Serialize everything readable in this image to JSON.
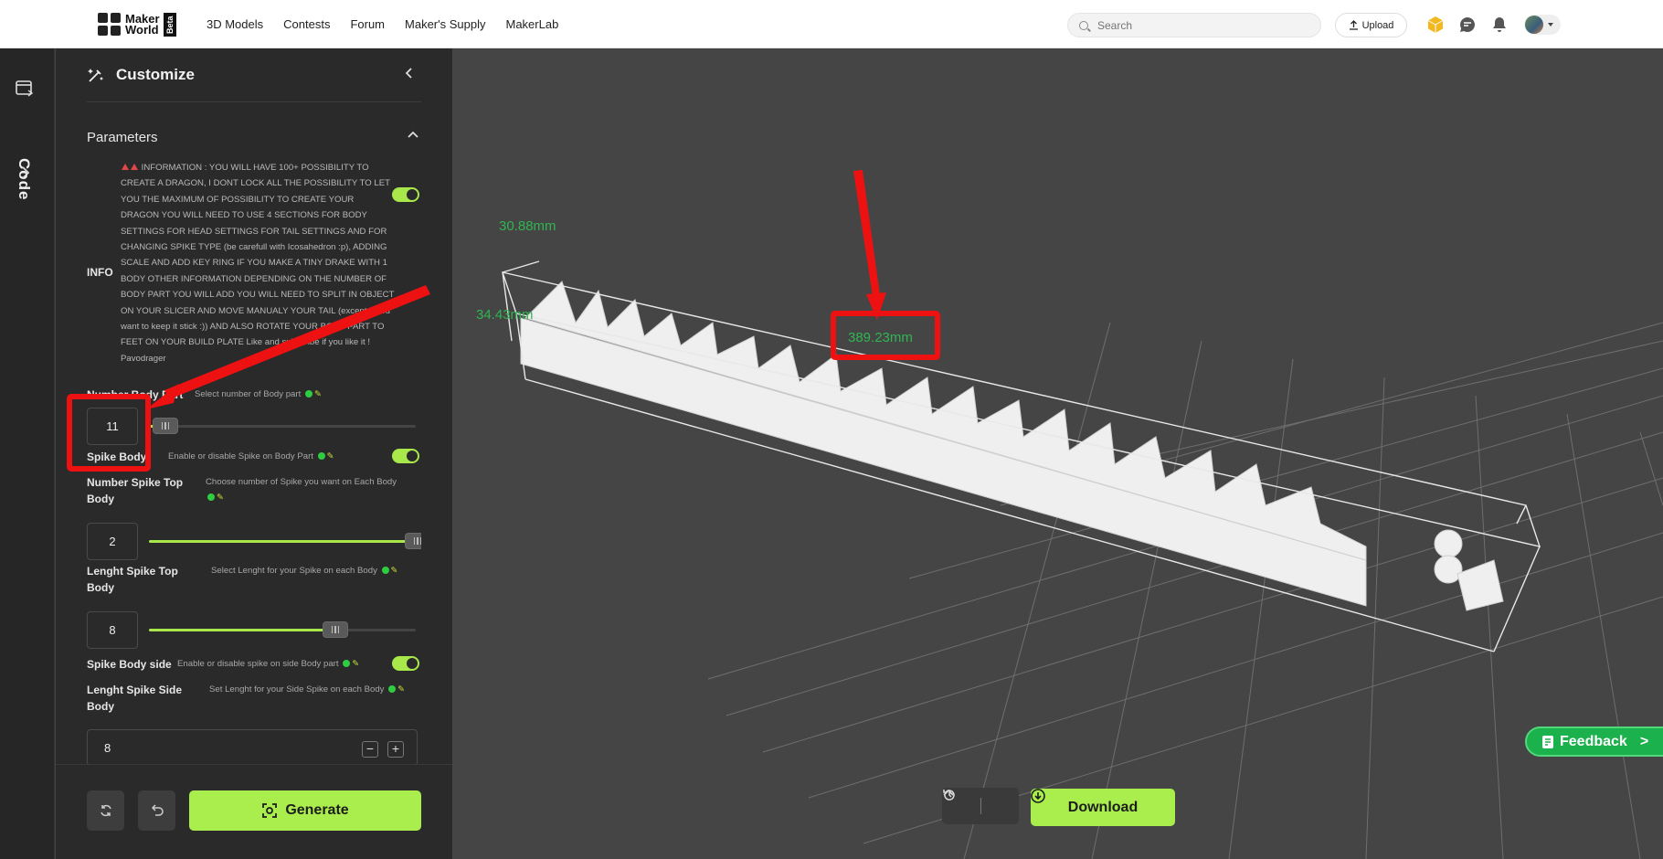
{
  "header": {
    "logo_line1": "Maker",
    "logo_line2": "World",
    "logo_badge": "Beta",
    "nav": [
      "3D Models",
      "Contests",
      "Forum",
      "Maker's Supply",
      "MakerLab"
    ],
    "search_placeholder": "Search",
    "upload_label": "Upload"
  },
  "rail": {
    "code_label": "Code"
  },
  "panel": {
    "title": "Customize",
    "section_title": "Parameters",
    "info": {
      "label": "INFO",
      "text": "INFORMATION : YOU WILL HAVE 100+ POSSIBILITY TO CREATE A DRAGON, I DONT LOCK ALL THE POSSIBILITY TO LET YOU THE MAXIMUM OF POSSIBILITY TO CREATE YOUR DRAGON YOU WILL NEED TO USE 4 SECTIONS FOR BODY SETTINGS FOR HEAD SETTINGS FOR TAIL SETTINGS AND FOR CHANGING SPIKE TYPE (be carefull with Icosahedron :p), ADDING SCALE AND ADD KEY RING IF YOU MAKE A TINY DRAKE WITH 1 BODY OTHER INFORMATION DEPENDING ON THE NUMBER OF BODY PART YOU WILL ADD YOU WILL NEED TO SPLIT IN OBJECT ON YOUR SLICER AND MOVE MANUALY YOUR TAIL (except if you want to keep it stick :)) AND ALSO ROTATE YOUR BODY PART TO FEET ON YOUR BUILD PLATE Like and subscribe if you like it ! Pavodrager",
      "enabled": true
    },
    "params": {
      "number_body_part": {
        "label": "Number Body Part",
        "desc": "Select number of Body part",
        "value": "11",
        "fraction": 0.04
      },
      "spike_body": {
        "label": "Spike Body",
        "desc": "Enable or disable Spike on Body Part",
        "enabled": true
      },
      "number_spike_top": {
        "label": "Number Spike Top Body",
        "desc": "Choose number of Spike you want on Each Body",
        "value": "2",
        "fraction": 1.0
      },
      "length_spike_top": {
        "label": "Lenght Spike Top Body",
        "desc": "Select Lenght for your Spike on each Body",
        "value": "8",
        "fraction": 0.7
      },
      "spike_body_side": {
        "label": "Spike Body side",
        "desc": "Enable or disable spike on side Body part",
        "enabled": true
      },
      "length_spike_side": {
        "label": "Lenght Spike Side Body",
        "desc": "Set Lenght for your Side Spike on each Body",
        "value": "8"
      }
    },
    "generate_label": "Generate"
  },
  "viewport": {
    "dim_width": "30.88mm",
    "dim_height": "34.43mm",
    "dim_length": "389.23mm",
    "download_label": "Download",
    "feedback_label": "Feedback"
  },
  "colors": {
    "accent": "#a9ee4c",
    "annotation": "#ee1111",
    "dimension": "#30b552"
  }
}
